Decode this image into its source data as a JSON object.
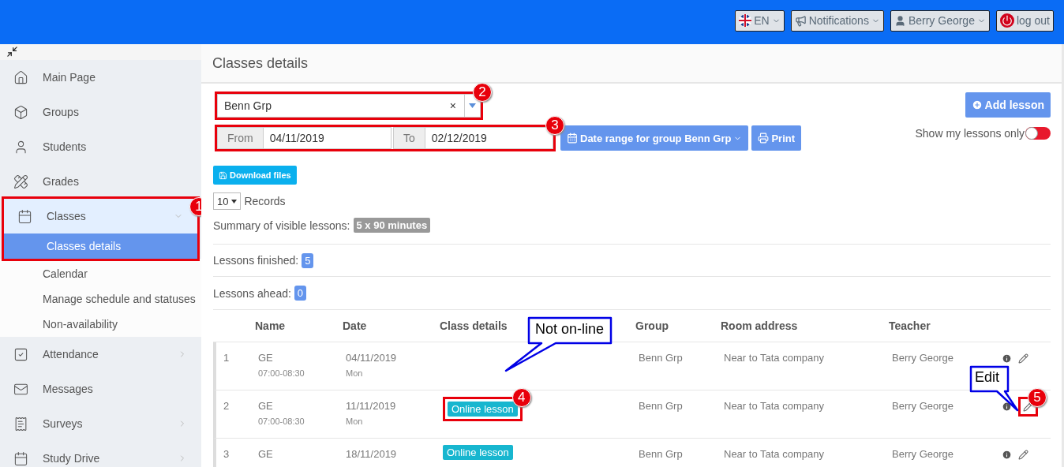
{
  "topbar": {
    "buttons": [
      {
        "kind": "language",
        "label": "EN"
      },
      {
        "kind": "notifications",
        "label": "Notifications"
      },
      {
        "kind": "user",
        "label": "Berry George"
      },
      {
        "kind": "logout",
        "label": "log out"
      }
    ]
  },
  "sidebar": {
    "items": [
      {
        "kind": "link",
        "label": "Main Page"
      },
      {
        "kind": "link",
        "label": "Groups"
      },
      {
        "kind": "link",
        "label": "Students"
      },
      {
        "kind": "link",
        "label": "Grades"
      },
      {
        "kind": "menu",
        "label": "Classes",
        "expanded": true,
        "callout": "1",
        "children": [
          {
            "label": "Classes details",
            "selected": true
          },
          {
            "label": "Calendar",
            "selected": false
          },
          {
            "label": "Manage schedule and statuses",
            "selected": false
          },
          {
            "label": "Non-availability",
            "selected": false
          }
        ]
      },
      {
        "kind": "menu",
        "label": "Attendance",
        "expanded": false
      },
      {
        "kind": "link",
        "label": "Messages"
      },
      {
        "kind": "menu",
        "label": "Surveys",
        "expanded": false
      },
      {
        "kind": "menu",
        "label": "Study Drive",
        "expanded": false
      }
    ]
  },
  "page_title": "Classes details",
  "group_select": {
    "value": "Benn Grp",
    "clear": "×",
    "callout": "2"
  },
  "date_range": {
    "from_label": "From",
    "from": "04/11/2019",
    "to_label": "To",
    "to": "02/12/2019",
    "callout": "3"
  },
  "date_range_button": "Date range for group Benn Grp",
  "print_button": "Print",
  "add_lesson_button": "Add lesson",
  "my_lessons_toggle": {
    "label": "Show my lessons only",
    "on": false
  },
  "download_button": "Download files",
  "records": {
    "value": "10",
    "label": "Records"
  },
  "summary": {
    "label": "Summary of visible lessons:",
    "badge": "5 x 90 minutes"
  },
  "finished": {
    "label": "Lessons finished:",
    "count": "5"
  },
  "ahead": {
    "label": "Lessons ahead:",
    "count": "0"
  },
  "table": {
    "columns": [
      "Name",
      "Date",
      "Class details",
      "Group",
      "Room address",
      "Teacher"
    ],
    "rows": [
      {
        "index": "1",
        "name": "GE",
        "time": "07:00-08:30",
        "date": "04/11/2019",
        "day": "Mon",
        "group": "Benn Grp",
        "room": "Near to Tata company",
        "teacher": "Berry George",
        "note": "Not on-line"
      },
      {
        "index": "2",
        "name": "GE",
        "time": "07:00-08:30",
        "date": "11/11/2019",
        "day": "Mon",
        "online": "Online lesson",
        "online_callout": "4",
        "group": "Benn Grp",
        "room": "Near to Tata company",
        "teacher": "Berry George",
        "edit_note": "Edit",
        "edit_callout": "5"
      },
      {
        "index": "3",
        "name": "GE",
        "date": "18/11/2019",
        "online": "Online lesson",
        "group": "Benn Grp",
        "room": "Near to Tata company",
        "teacher": "Berry George"
      }
    ]
  }
}
